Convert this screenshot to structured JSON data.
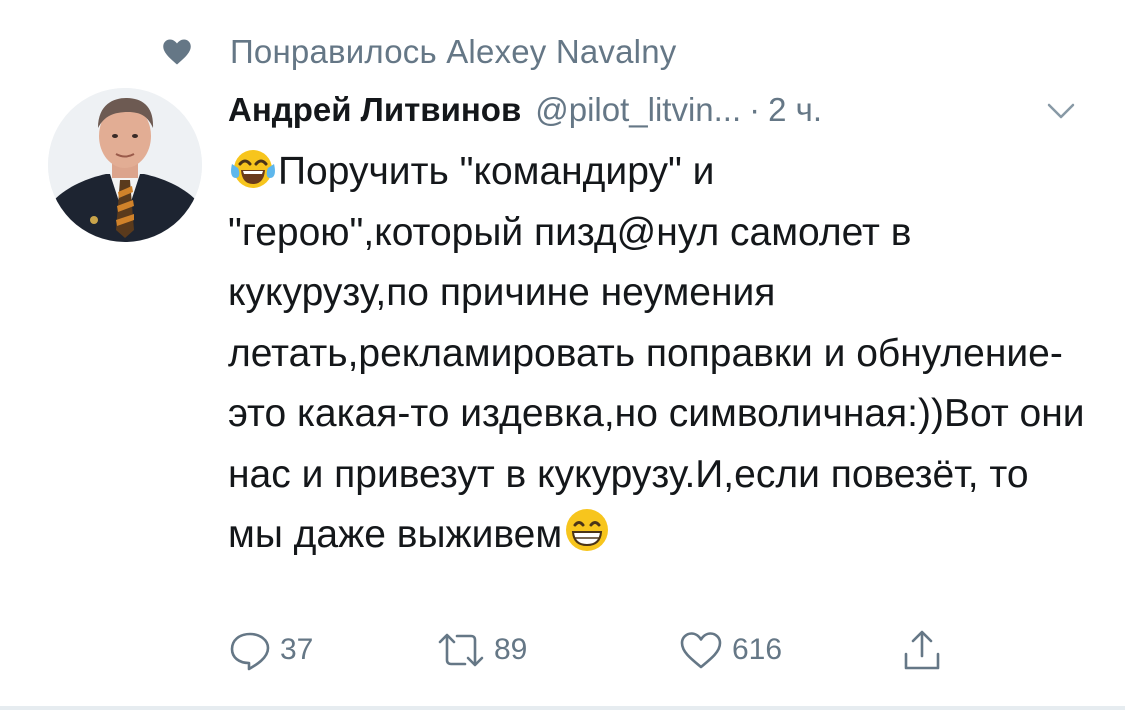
{
  "social_context": {
    "text": "Понравилось Alexey Navalny",
    "icon": "heart-filled-icon"
  },
  "tweet": {
    "author_name": "Андрей Литвинов",
    "handle": "@pilot_litvin...",
    "separator": "·",
    "time": "2 ч.",
    "text_line1": "Поручить \"командиру\" и",
    "text_rest": "\"герою\",который пизд@нул самолет в кукурузу,по причине неумения летать,рекламировать поправки и обнуление-это какая-то издевка,но символичная:))Вот они нас и привезут в кукурузу.И,если повезёт, то мы даже выживем",
    "leading_emoji": "face-with-tears-of-joy-emoji",
    "trailing_emoji": "grinning-face-with-smiling-eyes-emoji"
  },
  "actions": {
    "reply_count": "37",
    "retweet_count": "89",
    "like_count": "616"
  },
  "colors": {
    "text_primary": "#14171a",
    "text_secondary": "#657786",
    "emoji_yellow": "#f7c51d",
    "divider": "#e6ecf0"
  }
}
